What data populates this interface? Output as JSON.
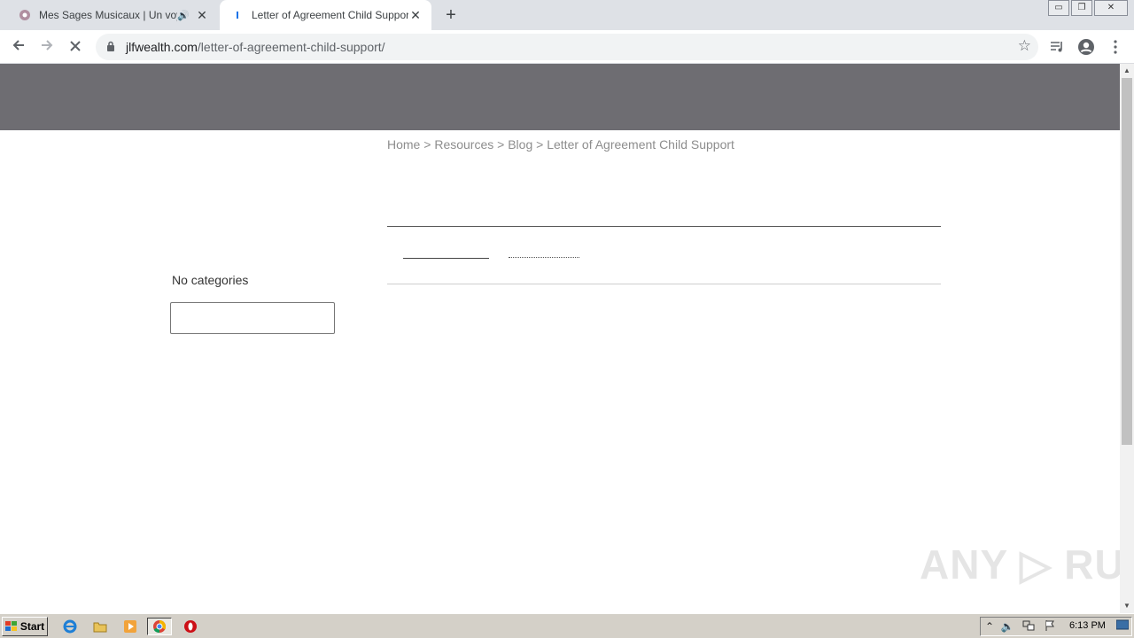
{
  "browser": {
    "tabs": [
      {
        "title": "Mes Sages Musicaux | Un voyage",
        "active": false,
        "audio": true
      },
      {
        "title": "Letter of Agreement Child Support - ",
        "active": true,
        "audio": false
      }
    ],
    "new_tab": "+",
    "window_controls": {
      "minimize": "▭",
      "restore": "❐",
      "close": "✕"
    },
    "url_host": "jlfwealth.com",
    "url_path": "/letter-of-agreement-child-support/",
    "icons": {
      "back": "back-arrow-icon",
      "forward": "forward-arrow-icon",
      "stop": "stop-loading-icon",
      "lock": "lock-icon",
      "star": "bookmark-star-icon",
      "media": "media-control-icon",
      "profile": "profile-icon",
      "menu": "kebab-menu-icon"
    }
  },
  "page": {
    "header_color": "#6e6d72",
    "breadcrumb": {
      "home": "Home",
      "sep": ">",
      "resources": "Resources",
      "blog": "Blog",
      "current": "Letter of Agreement Child Support"
    },
    "sidebar": {
      "no_categories": "No categories",
      "search_value": ""
    }
  },
  "watermark": "ANY ▷ RUN",
  "taskbar": {
    "start_label": "Start",
    "clock": "6:13 PM"
  }
}
